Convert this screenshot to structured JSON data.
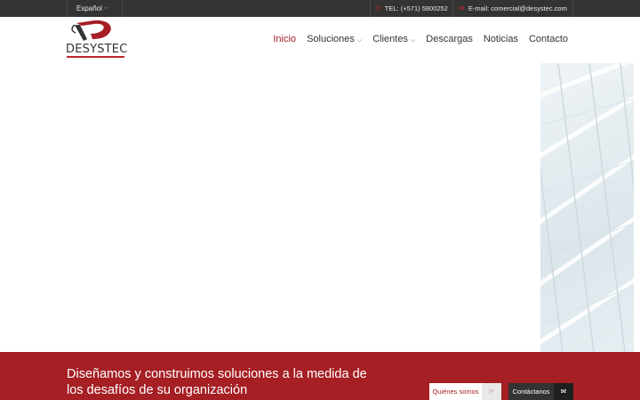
{
  "topbar": {
    "language_label": "Español",
    "phone_text": "TEL: (+571) 5800252",
    "email_text": "E-mail: comercial@desystec.com"
  },
  "logo": {
    "text": "DESYSTEC"
  },
  "nav": {
    "items": [
      {
        "label": "Inicio",
        "active": true
      },
      {
        "label": "Soluciones",
        "dropdown": true
      },
      {
        "label": "Clientes",
        "dropdown": true
      },
      {
        "label": "Descargas"
      },
      {
        "label": "Noticias"
      },
      {
        "label": "Contacto"
      }
    ]
  },
  "band": {
    "title": "Diseñamos y construimos soluciones a la medida de los desafíos de su organización",
    "about_button": "Quiénes somos",
    "contact_button": "Contáctanos"
  },
  "colors": {
    "brand_red": "#a51f24",
    "topbar": "#333333"
  },
  "icons": {
    "phone": "phone-icon",
    "email": "envelope-icon",
    "about": "hand-pointer-icon",
    "contact": "envelope-icon"
  }
}
